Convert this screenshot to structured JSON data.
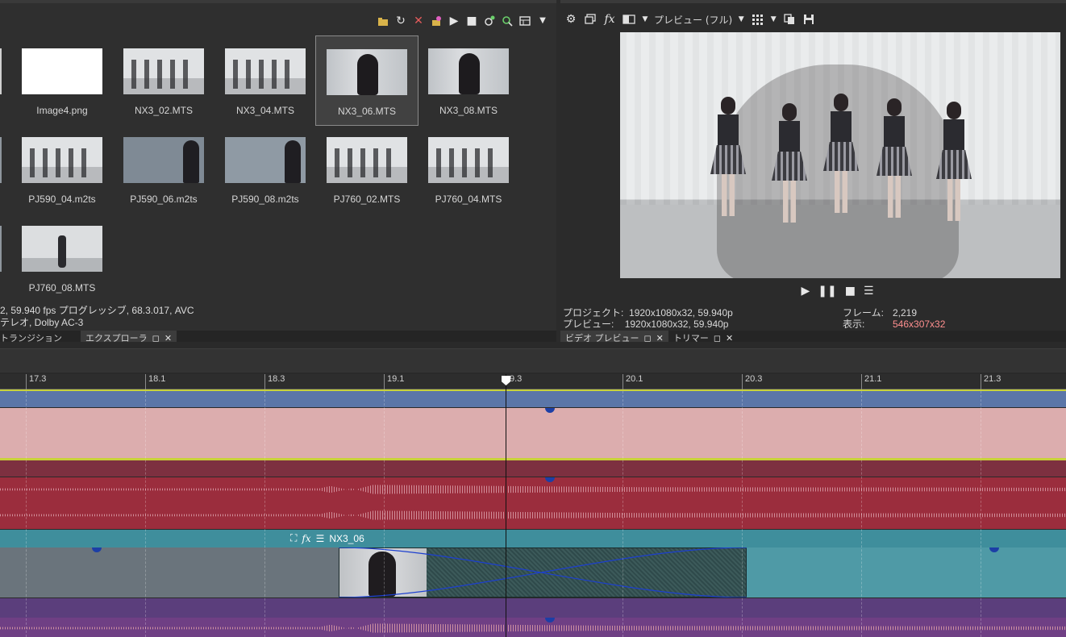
{
  "explorer": {
    "toolbar_icons": [
      "folder-up-icon",
      "refresh-icon",
      "delete-icon",
      "add-to-project-icon",
      "play-icon",
      "stop-icon",
      "auto-preview-icon",
      "search-icon",
      "view-mode-icon",
      "dropdown-icon"
    ],
    "thumbnails": [
      {
        "name": "Image4.png"
      },
      {
        "name": "NX3_02.MTS"
      },
      {
        "name": "NX3_04.MTS"
      },
      {
        "name": "NX3_06.MTS",
        "selected": true
      },
      {
        "name": "NX3_08.MTS"
      },
      {
        "name": "PJ590_04.m2ts"
      },
      {
        "name": "PJ590_06.m2ts"
      },
      {
        "name": "PJ590_08.m2ts"
      },
      {
        "name": "PJ760_02.MTS"
      },
      {
        "name": "PJ760_04.MTS"
      },
      {
        "name": "PJ760_08.MTS"
      }
    ],
    "file_info_line1": "2, 59.940 fps プログレッシブ, 68.3.017, AVC",
    "file_info_line2": "テレオ, Dolby AC-3",
    "tabs": {
      "transition": "トランジション",
      "explorer": "エクスプローラ"
    }
  },
  "preview": {
    "mode_label": "プレビュー (フル)",
    "project_label": "プロジェクト:",
    "project_value": "1920x1080x32, 59.940p",
    "preview_label": "プレビュー:",
    "preview_value": "1920x1080x32, 59.940p",
    "frame_label": "フレーム:",
    "frame_value": "2,219",
    "display_label": "表示:",
    "display_value": "546x307x32",
    "display_color": "#ff8f8f",
    "tabs": {
      "video_preview": "ビデオ プレビュー",
      "trimmer": "トリマー"
    }
  },
  "timeline": {
    "ruler_ticks": [
      "17.3",
      "18.1",
      "18.3",
      "19.1",
      "9.3",
      "20.1",
      "20.3",
      "21.1",
      "21.3"
    ],
    "clip_name": "NX3_06"
  }
}
